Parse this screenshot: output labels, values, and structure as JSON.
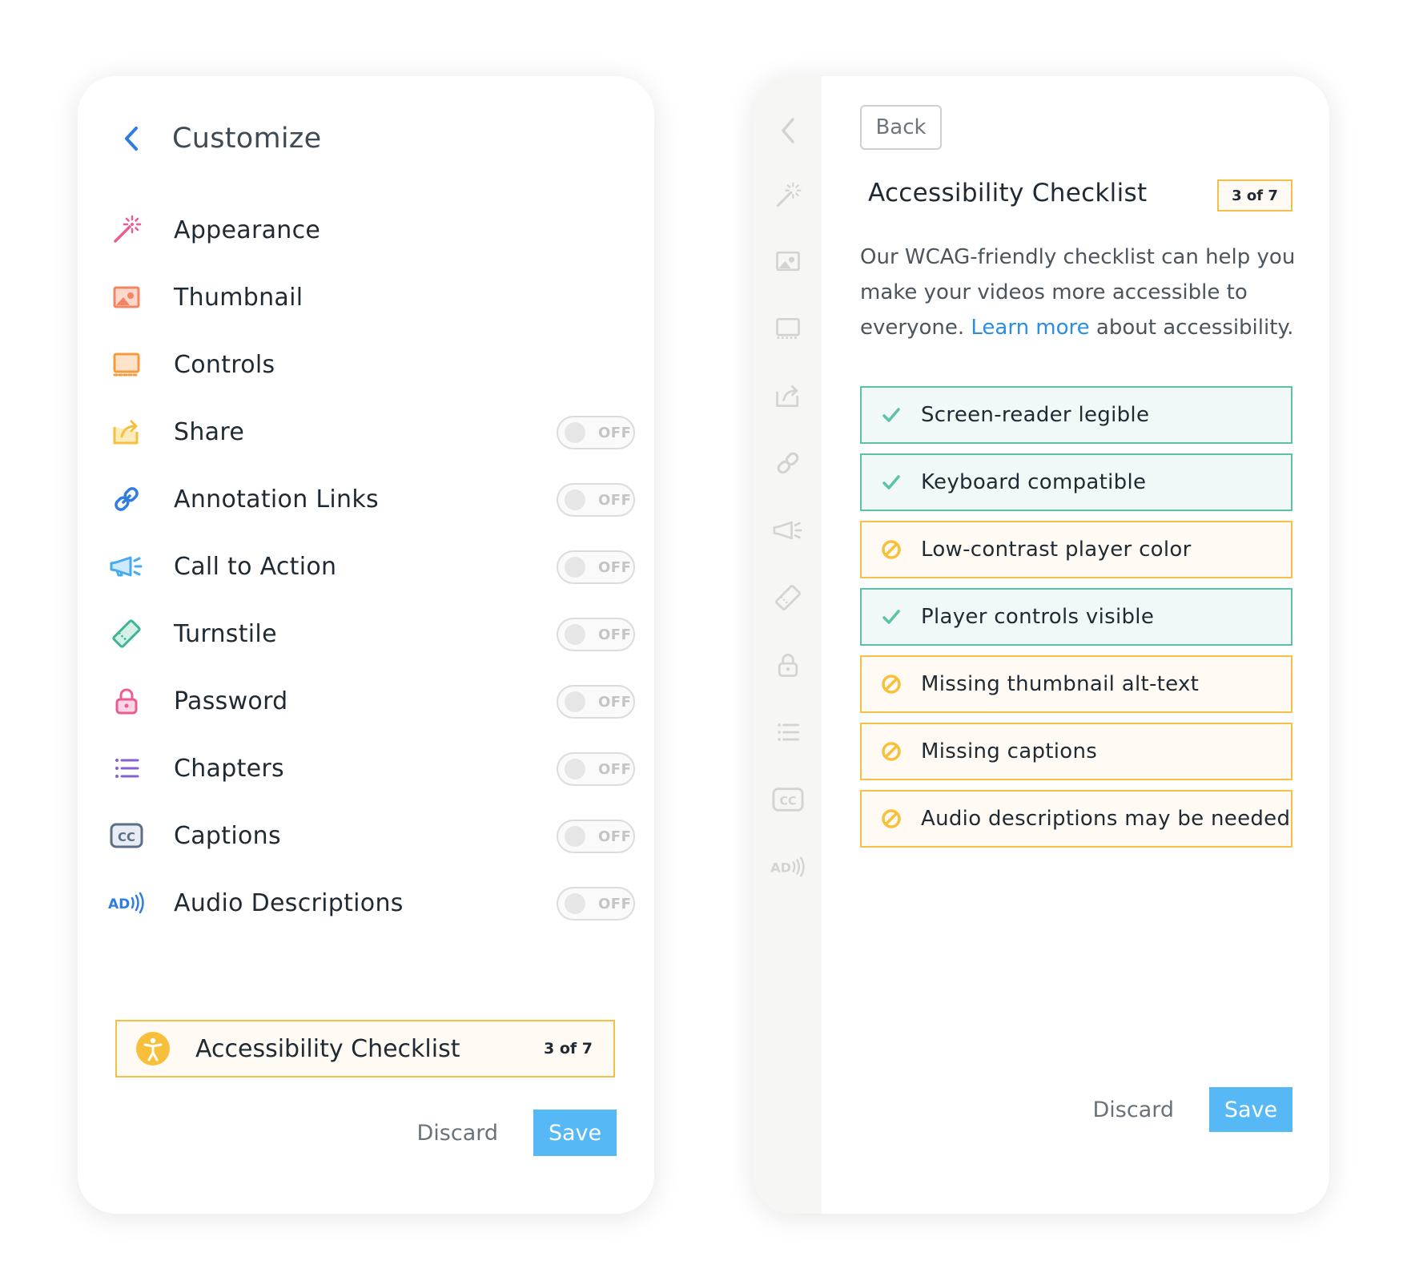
{
  "left": {
    "title": "Customize",
    "items": [
      {
        "label": "Appearance",
        "icon": "magic-wand-icon",
        "color": "#ec5b93",
        "toggle": null
      },
      {
        "label": "Thumbnail",
        "icon": "image-icon",
        "color": "#f38563",
        "toggle": null
      },
      {
        "label": "Controls",
        "icon": "monitor-icon",
        "color": "#f69a3c",
        "toggle": null
      },
      {
        "label": "Share",
        "icon": "share-icon",
        "color": "#f8c03a",
        "toggle": "OFF"
      },
      {
        "label": "Annotation Links",
        "icon": "link-icon",
        "color": "#2f7de1",
        "toggle": "OFF"
      },
      {
        "label": "Call to Action",
        "icon": "megaphone-icon",
        "color": "#45aaf0",
        "toggle": "OFF"
      },
      {
        "label": "Turnstile",
        "icon": "ticket-icon",
        "color": "#3fb596",
        "toggle": "OFF"
      },
      {
        "label": "Password",
        "icon": "lock-icon",
        "color": "#ec5b93",
        "toggle": "OFF"
      },
      {
        "label": "Chapters",
        "icon": "list-icon",
        "color": "#8660d4",
        "toggle": "OFF"
      },
      {
        "label": "Captions",
        "icon": "closed-captions-icon",
        "color": "#5b6f8a",
        "toggle": "OFF"
      },
      {
        "label": "Audio Descriptions",
        "icon": "audio-description-icon",
        "color": "#2f7de1",
        "toggle": "OFF"
      }
    ],
    "checklist": {
      "label": "Accessibility Checklist",
      "count": "3 of 7"
    },
    "discard": "Discard",
    "save": "Save"
  },
  "right": {
    "back": "Back",
    "title": "Accessibility Checklist",
    "badge": "3 of 7",
    "desc_before": "Our WCAG-friendly checklist can help you make your videos more accessible to everyone. ",
    "desc_link": "Learn more",
    "desc_after": " about accessibility.",
    "checks": [
      {
        "label": "Screen-reader legible",
        "status": "pass"
      },
      {
        "label": "Keyboard compatible",
        "status": "pass"
      },
      {
        "label": "Low-contrast player color",
        "status": "warn"
      },
      {
        "label": "Player controls visible",
        "status": "pass"
      },
      {
        "label": "Missing thumbnail alt-text",
        "status": "warn"
      },
      {
        "label": "Missing captions",
        "status": "warn"
      },
      {
        "label": "Audio descriptions may be needed",
        "status": "warn"
      }
    ],
    "discard": "Discard",
    "save": "Save"
  },
  "colors": {
    "accent": "#56b9f6",
    "pass": "#5cc2a6",
    "warn": "#f4bf45",
    "link": "#2a8ee8",
    "rail_icon": "#d3d3d3"
  }
}
